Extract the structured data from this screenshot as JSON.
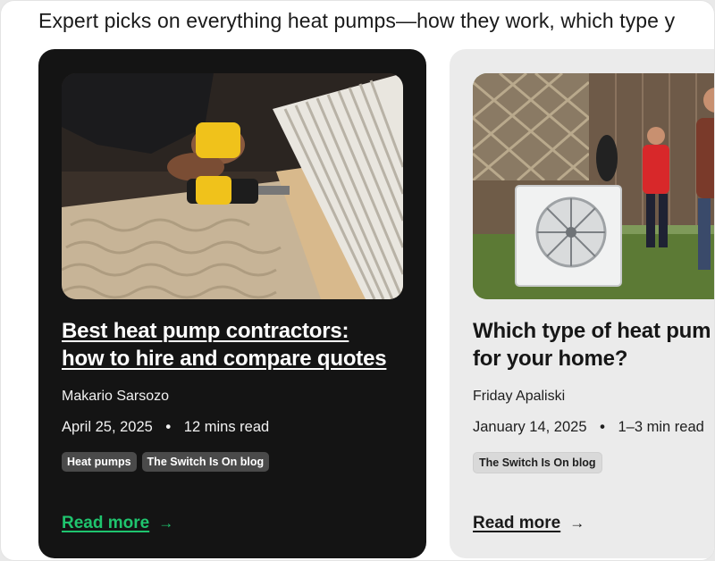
{
  "intro_text": "Expert picks on everything heat pumps—how they work, which type y",
  "cards": [
    {
      "title_line1": "Best heat pump contractors:",
      "title_line2": "how to hire and compare quotes",
      "author": "Makario Sarsozo",
      "date": "April 25, 2025",
      "separator": "•",
      "read_time": "12 mins read",
      "tags": [
        "Heat pumps",
        "The Switch Is On blog"
      ],
      "read_more": "Read more",
      "arrow": "→",
      "image_icon": "heat-pump-installation-photo"
    },
    {
      "title_line1": "Which type of heat pum",
      "title_line2": "for your home?",
      "author": "Friday Apaliski",
      "date": "January 14, 2025",
      "separator": "•",
      "read_time": "1–3 min read",
      "tags": [
        "The Switch Is On blog"
      ],
      "read_more": "Read more",
      "arrow": "→",
      "image_icon": "outdoor-heat-pump-family-photo"
    }
  ],
  "colors": {
    "dark_card": "#141414",
    "light_card": "#ebebeb",
    "accent_green": "#1fc46e"
  }
}
